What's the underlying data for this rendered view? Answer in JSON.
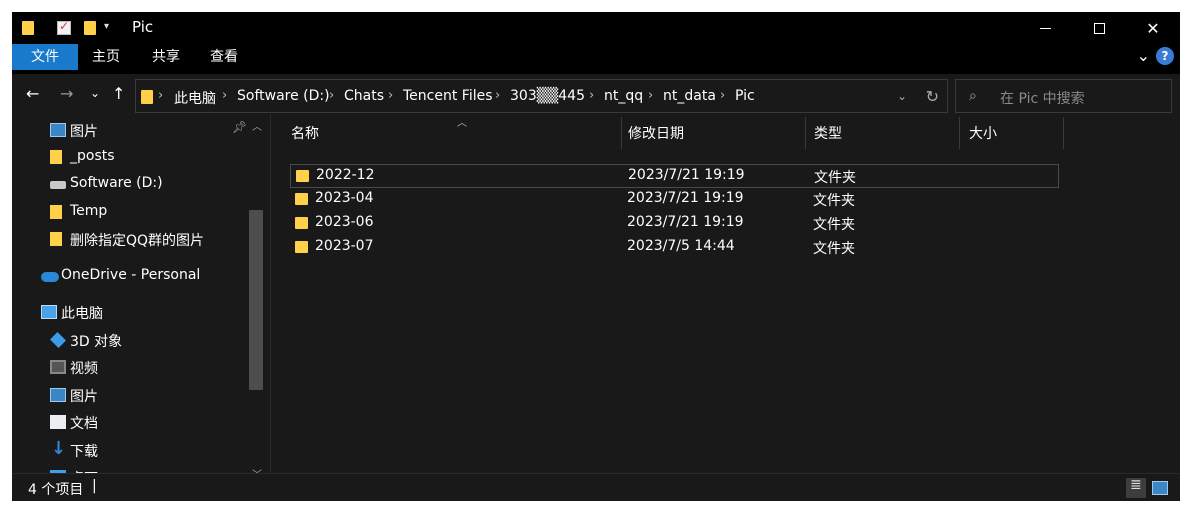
{
  "window": {
    "title": "Pic",
    "controls": {
      "minimize": "",
      "maximize": "",
      "close": "✕"
    }
  },
  "ribbon": {
    "tabs": [
      "文件",
      "主页",
      "共享",
      "查看"
    ],
    "help": "?"
  },
  "address": {
    "breadcrumbs": [
      "此电脑",
      "Software (D:)",
      "Chats",
      "Tencent Files",
      "303▒▒445",
      "nt_qq",
      "nt_data",
      "Pic"
    ],
    "separator": "›"
  },
  "search": {
    "placeholder": "在 Pic 中搜索"
  },
  "sidebar": {
    "items": [
      {
        "label": "图片",
        "icon": "pictures-icon",
        "pinned": true
      },
      {
        "label": "_posts",
        "icon": "folder-icon"
      },
      {
        "label": "Software (D:)",
        "icon": "drive-icon"
      },
      {
        "label": "Temp",
        "icon": "folder-icon"
      },
      {
        "label": "删除指定QQ群的图片",
        "icon": "folder-icon"
      },
      {
        "label": "OneDrive - Personal",
        "icon": "onedrive-cloud-icon"
      },
      {
        "label": "此电脑",
        "icon": "this-pc-icon"
      },
      {
        "label": "3D 对象",
        "icon": "3d-objects-icon"
      },
      {
        "label": "视频",
        "icon": "videos-icon"
      },
      {
        "label": "图片",
        "icon": "pictures-icon"
      },
      {
        "label": "文档",
        "icon": "documents-icon"
      },
      {
        "label": "下载",
        "icon": "downloads-icon"
      },
      {
        "label": "桌面",
        "icon": "desktop-icon"
      }
    ]
  },
  "columns": [
    "名称",
    "修改日期",
    "类型",
    "大小"
  ],
  "files": [
    {
      "name": "2022-12",
      "modified": "2023/7/21 19:19",
      "type": "文件夹",
      "size": ""
    },
    {
      "name": "2023-04",
      "modified": "2023/7/21 19:19",
      "type": "文件夹",
      "size": ""
    },
    {
      "name": "2023-06",
      "modified": "2023/7/21 19:19",
      "type": "文件夹",
      "size": ""
    },
    {
      "name": "2023-07",
      "modified": "2023/7/5 14:44",
      "type": "文件夹",
      "size": ""
    }
  ],
  "status": {
    "item_count": "4 个项目",
    "cursor": "|"
  },
  "colors": {
    "accent": "#1979ca",
    "background": "#191919",
    "titlebar": "#000000",
    "folder": "#ffd04a"
  }
}
